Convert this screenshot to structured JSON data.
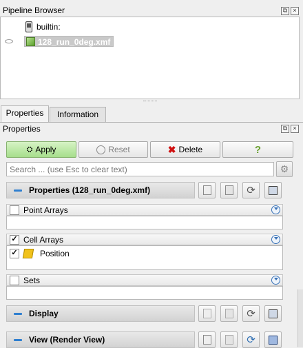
{
  "pipeline_browser": {
    "title": "Pipeline Browser",
    "root_label": "builtin:",
    "file_label": "128_run_0deg.xmf"
  },
  "tabs": [
    {
      "label": "Properties",
      "active": true
    },
    {
      "label": "Information",
      "active": false
    }
  ],
  "properties_panel": {
    "title": "Properties",
    "apply_label": "Apply",
    "reset_label": "Reset",
    "delete_label": "Delete",
    "help_label": "?",
    "search_placeholder": "Search ... (use Esc to clear text)"
  },
  "sections": {
    "properties": {
      "title": "Properties (128_run_0deg.xmf)"
    },
    "display": {
      "title": "Display"
    },
    "view": {
      "title": "View (Render View)"
    }
  },
  "groups": {
    "point_arrays": {
      "label": "Point Arrays",
      "checked": false
    },
    "cell_arrays": {
      "label": "Cell Arrays",
      "checked": true,
      "items": [
        {
          "label": "Position",
          "checked": true
        }
      ]
    },
    "sets": {
      "label": "Sets",
      "checked": false
    }
  },
  "colors": {
    "apply_green": "#a6de8c",
    "accent_blue": "#2f7fd0",
    "delete_red": "#d01010"
  }
}
